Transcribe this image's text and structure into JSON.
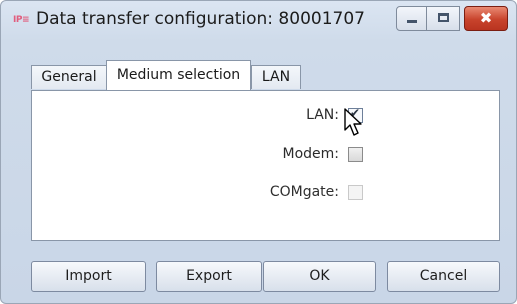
{
  "window": {
    "app_icon_text": "IP≡",
    "title": "Data transfer configuration: 80001707",
    "minimize_glyph": "minimize-icon",
    "maximize_glyph": "maximize-icon",
    "close_glyph": "✖"
  },
  "tabs": [
    {
      "label": "General",
      "selected": false
    },
    {
      "label": "Medium selection",
      "selected": true
    },
    {
      "label": "LAN",
      "selected": false
    }
  ],
  "medium_selection": {
    "lan_label": "LAN:",
    "lan_checked": true,
    "modem_label": "Modem:",
    "modem_checked": false,
    "comgate_label": "COMgate:",
    "comgate_checked": false,
    "comgate_enabled": false,
    "check_glyph": "✔"
  },
  "buttons": {
    "import_label": "Import",
    "export_label": "Export",
    "ok_label": "OK",
    "cancel_label": "Cancel"
  },
  "colors": {
    "close_button": "#c8432c",
    "window_frame": "#c9d6e7"
  }
}
